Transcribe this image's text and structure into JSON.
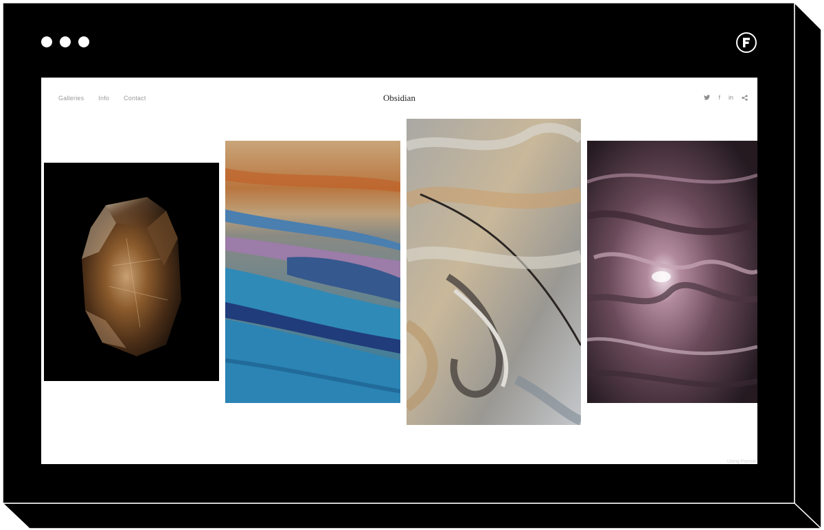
{
  "window": {
    "controls": [
      "close",
      "minimize",
      "maximize"
    ],
    "logo_icon": "framer-logo-icon"
  },
  "site": {
    "title": "Obsidian",
    "nav": [
      "Galleries",
      "Info",
      "Contact"
    ],
    "social_icons": [
      "twitter-icon",
      "facebook-icon",
      "linkedin-icon",
      "share-icon"
    ],
    "social_labels": {
      "twitter": "𝕥",
      "facebook": "f",
      "linkedin": "in"
    },
    "footer_note": "Using Format"
  },
  "gallery": {
    "images": [
      {
        "name": "smoky-quartz-crystal"
      },
      {
        "name": "blue-orange-sediment-layers"
      },
      {
        "name": "grey-ochre-rock-swirl"
      },
      {
        "name": "purple-marbled-stone"
      }
    ]
  },
  "colors": {
    "frame": "#000000",
    "screen": "#ffffff",
    "nav_text": "#9a9a9a",
    "title_text": "#222222"
  }
}
